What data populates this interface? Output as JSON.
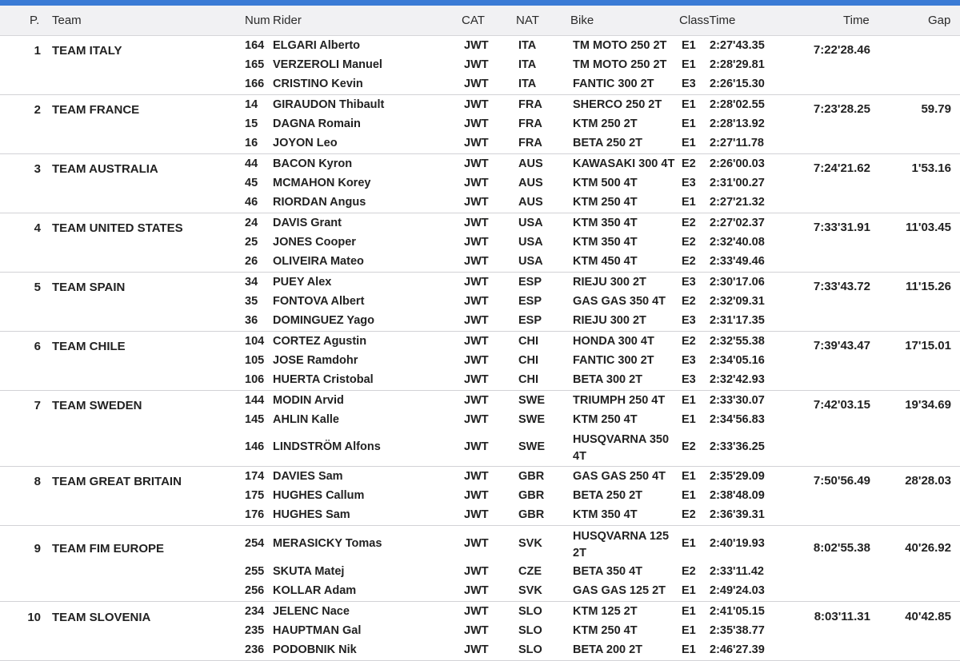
{
  "header": {
    "pos": "P.",
    "team": "Team",
    "num": "Num",
    "rider": "Rider",
    "cat": "CAT",
    "nat": "NAT",
    "bike": "Bike",
    "class_time": "ClassTime",
    "time": "Time",
    "gap": "Gap"
  },
  "teams": [
    {
      "pos": "1",
      "name": "TEAM ITALY",
      "time": "7:22'28.46",
      "gap": "",
      "riders": [
        {
          "num": "164",
          "name": "ELGARI Alberto",
          "cat": "JWT",
          "nat": "ITA",
          "bike": "TM MOTO 250 2T",
          "class": "E1",
          "time": "2:27'43.35"
        },
        {
          "num": "165",
          "name": "VERZEROLI Manuel",
          "cat": "JWT",
          "nat": "ITA",
          "bike": "TM MOTO 250 2T",
          "class": "E1",
          "time": "2:28'29.81"
        },
        {
          "num": "166",
          "name": "CRISTINO Kevin",
          "cat": "JWT",
          "nat": "ITA",
          "bike": "FANTIC 300 2T",
          "class": "E3",
          "time": "2:26'15.30"
        }
      ]
    },
    {
      "pos": "2",
      "name": "TEAM FRANCE",
      "time": "7:23'28.25",
      "gap": "59.79",
      "riders": [
        {
          "num": "14",
          "name": "GIRAUDON Thibault",
          "cat": "JWT",
          "nat": "FRA",
          "bike": "SHERCO 250 2T",
          "class": "E1",
          "time": "2:28'02.55"
        },
        {
          "num": "15",
          "name": "DAGNA Romain",
          "cat": "JWT",
          "nat": "FRA",
          "bike": "KTM 250 2T",
          "class": "E1",
          "time": "2:28'13.92"
        },
        {
          "num": "16",
          "name": "JOYON Leo",
          "cat": "JWT",
          "nat": "FRA",
          "bike": "BETA 250 2T",
          "class": "E1",
          "time": "2:27'11.78"
        }
      ]
    },
    {
      "pos": "3",
      "name": "TEAM AUSTRALIA",
      "time": "7:24'21.62",
      "gap": "1'53.16",
      "riders": [
        {
          "num": "44",
          "name": "BACON Kyron",
          "cat": "JWT",
          "nat": "AUS",
          "bike": "KAWASAKI 300 4T",
          "class": "E2",
          "time": "2:26'00.03"
        },
        {
          "num": "45",
          "name": "MCMAHON Korey",
          "cat": "JWT",
          "nat": "AUS",
          "bike": "KTM 500 4T",
          "class": "E3",
          "time": "2:31'00.27"
        },
        {
          "num": "46",
          "name": "RIORDAN Angus",
          "cat": "JWT",
          "nat": "AUS",
          "bike": "KTM 250 4T",
          "class": "E1",
          "time": "2:27'21.32"
        }
      ]
    },
    {
      "pos": "4",
      "name": "TEAM UNITED STATES",
      "time": "7:33'31.91",
      "gap": "11'03.45",
      "riders": [
        {
          "num": "24",
          "name": "DAVIS Grant",
          "cat": "JWT",
          "nat": "USA",
          "bike": "KTM 350 4T",
          "class": "E2",
          "time": "2:27'02.37"
        },
        {
          "num": "25",
          "name": "JONES Cooper",
          "cat": "JWT",
          "nat": "USA",
          "bike": "KTM 350 4T",
          "class": "E2",
          "time": "2:32'40.08"
        },
        {
          "num": "26",
          "name": "OLIVEIRA Mateo",
          "cat": "JWT",
          "nat": "USA",
          "bike": "KTM 450 4T",
          "class": "E2",
          "time": "2:33'49.46"
        }
      ]
    },
    {
      "pos": "5",
      "name": "TEAM SPAIN",
      "time": "7:33'43.72",
      "gap": "11'15.26",
      "riders": [
        {
          "num": "34",
          "name": "PUEY Alex",
          "cat": "JWT",
          "nat": "ESP",
          "bike": "RIEJU 300 2T",
          "class": "E3",
          "time": "2:30'17.06"
        },
        {
          "num": "35",
          "name": "FONTOVA Albert",
          "cat": "JWT",
          "nat": "ESP",
          "bike": "GAS GAS 350 4T",
          "class": "E2",
          "time": "2:32'09.31"
        },
        {
          "num": "36",
          "name": "DOMINGUEZ Yago",
          "cat": "JWT",
          "nat": "ESP",
          "bike": "RIEJU 300 2T",
          "class": "E3",
          "time": "2:31'17.35"
        }
      ]
    },
    {
      "pos": "6",
      "name": "TEAM CHILE",
      "time": "7:39'43.47",
      "gap": "17'15.01",
      "riders": [
        {
          "num": "104",
          "name": "CORTEZ Agustin",
          "cat": "JWT",
          "nat": "CHI",
          "bike": "HONDA 300 4T",
          "class": "E2",
          "time": "2:32'55.38"
        },
        {
          "num": "105",
          "name": "JOSE Ramdohr",
          "cat": "JWT",
          "nat": "CHI",
          "bike": "FANTIC 300 2T",
          "class": "E3",
          "time": "2:34'05.16"
        },
        {
          "num": "106",
          "name": "HUERTA Cristobal",
          "cat": "JWT",
          "nat": "CHI",
          "bike": "BETA 300 2T",
          "class": "E3",
          "time": "2:32'42.93"
        }
      ]
    },
    {
      "pos": "7",
      "name": "TEAM SWEDEN",
      "time": "7:42'03.15",
      "gap": "19'34.69",
      "riders": [
        {
          "num": "144",
          "name": "MODIN Arvid",
          "cat": "JWT",
          "nat": "SWE",
          "bike": "TRIUMPH 250 4T",
          "class": "E1",
          "time": "2:33'30.07"
        },
        {
          "num": "145",
          "name": "AHLIN Kalle",
          "cat": "JWT",
          "nat": "SWE",
          "bike": "KTM 250 4T",
          "class": "E1",
          "time": "2:34'56.83"
        },
        {
          "num": "146",
          "name": "LINDSTRÖM Alfons",
          "cat": "JWT",
          "nat": "SWE",
          "bike": "HUSQVARNA 350 4T",
          "class": "E2",
          "time": "2:33'36.25",
          "tall": true
        }
      ]
    },
    {
      "pos": "8",
      "name": "TEAM GREAT BRITAIN",
      "time": "7:50'56.49",
      "gap": "28'28.03",
      "riders": [
        {
          "num": "174",
          "name": "DAVIES Sam",
          "cat": "JWT",
          "nat": "GBR",
          "bike": "GAS GAS 250 4T",
          "class": "E1",
          "time": "2:35'29.09"
        },
        {
          "num": "175",
          "name": "HUGHES Callum",
          "cat": "JWT",
          "nat": "GBR",
          "bike": "BETA 250 2T",
          "class": "E1",
          "time": "2:38'48.09"
        },
        {
          "num": "176",
          "name": "HUGHES Sam",
          "cat": "JWT",
          "nat": "GBR",
          "bike": "KTM 350 4T",
          "class": "E2",
          "time": "2:36'39.31"
        }
      ]
    },
    {
      "pos": "9",
      "name": "TEAM FIM EUROPE",
      "time": "8:02'55.38",
      "gap": "40'26.92",
      "riders": [
        {
          "num": "254",
          "name": "MERASICKY Tomas",
          "cat": "JWT",
          "nat": "SVK",
          "bike": "HUSQVARNA 125 2T",
          "class": "E1",
          "time": "2:40'19.93",
          "tall": true
        },
        {
          "num": "255",
          "name": "SKUTA Matej",
          "cat": "JWT",
          "nat": "CZE",
          "bike": "BETA 350 4T",
          "class": "E2",
          "time": "2:33'11.42"
        },
        {
          "num": "256",
          "name": "KOLLAR Adam",
          "cat": "JWT",
          "nat": "SVK",
          "bike": "GAS GAS 125 2T",
          "class": "E1",
          "time": "2:49'24.03"
        }
      ]
    },
    {
      "pos": "10",
      "name": "TEAM SLOVENIA",
      "time": "8:03'11.31",
      "gap": "40'42.85",
      "riders": [
        {
          "num": "234",
          "name": "JELENC Nace",
          "cat": "JWT",
          "nat": "SLO",
          "bike": "KTM 125 2T",
          "class": "E1",
          "time": "2:41'05.15"
        },
        {
          "num": "235",
          "name": "HAUPTMAN Gal",
          "cat": "JWT",
          "nat": "SLO",
          "bike": "KTM 250 4T",
          "class": "E1",
          "time": "2:35'38.77"
        },
        {
          "num": "236",
          "name": "PODOBNIK Nik",
          "cat": "JWT",
          "nat": "SLO",
          "bike": "BETA 200 2T",
          "class": "E1",
          "time": "2:46'27.39"
        }
      ]
    }
  ]
}
